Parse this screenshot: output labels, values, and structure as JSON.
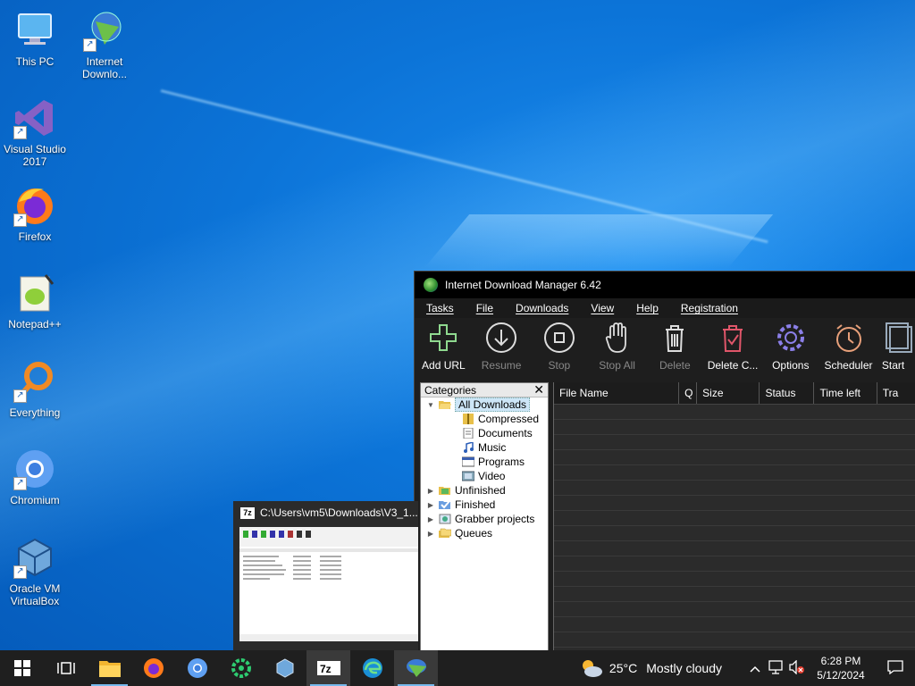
{
  "desktop": {
    "icons": [
      {
        "label": "This PC",
        "icon": "this-pc-icon"
      },
      {
        "label": "Internet Downlo...",
        "icon": "idm-icon"
      },
      {
        "label": "Visual Studio 2017",
        "icon": "visual-studio-icon"
      },
      {
        "label": "Firefox",
        "icon": "firefox-icon"
      },
      {
        "label": "Notepad++",
        "icon": "notepadpp-icon"
      },
      {
        "label": "Everything",
        "icon": "everything-icon"
      },
      {
        "label": "Chromium",
        "icon": "chromium-icon"
      },
      {
        "label": "Oracle VM VirtualBox",
        "icon": "virtualbox-icon"
      }
    ]
  },
  "idm": {
    "title": "Internet Download Manager 6.42",
    "menu": [
      "Tasks",
      "File",
      "Downloads",
      "View",
      "Help",
      "Registration"
    ],
    "toolbar": [
      {
        "label": "Add URL",
        "enabled": true
      },
      {
        "label": "Resume",
        "enabled": false
      },
      {
        "label": "Stop",
        "enabled": false
      },
      {
        "label": "Stop All",
        "enabled": false
      },
      {
        "label": "Delete",
        "enabled": false
      },
      {
        "label": "Delete C...",
        "enabled": true
      },
      {
        "label": "Options",
        "enabled": true
      },
      {
        "label": "Scheduler",
        "enabled": true
      },
      {
        "label": "Start",
        "enabled": true
      }
    ],
    "categories": {
      "title": "Categories",
      "close": "✕",
      "tree": [
        {
          "label": "All Downloads",
          "level": 0,
          "expanded": true,
          "selected": true
        },
        {
          "label": "Compressed",
          "level": 1
        },
        {
          "label": "Documents",
          "level": 1
        },
        {
          "label": "Music",
          "level": 1
        },
        {
          "label": "Programs",
          "level": 1
        },
        {
          "label": "Video",
          "level": 1
        },
        {
          "label": "Unfinished",
          "level": 0
        },
        {
          "label": "Finished",
          "level": 0
        },
        {
          "label": "Grabber projects",
          "level": 0
        },
        {
          "label": "Queues",
          "level": 0
        }
      ]
    },
    "columns": [
      "File Name",
      "Q",
      "Size",
      "Status",
      "Time left",
      "Tra"
    ]
  },
  "preview": {
    "title": "C:\\Users\\vm5\\Downloads\\V3_1...",
    "app_badge": "7z"
  },
  "taskbar": {
    "weather_temp": "25°C",
    "weather_text": "Mostly cloudy",
    "time": "6:28 PM",
    "date": "5/12/2024"
  },
  "colors": {
    "desktop_blue": "#0c74d8",
    "taskbar": "#1f1f1f",
    "idm_titlebar": "#000000",
    "selection": "#cde6f7"
  }
}
